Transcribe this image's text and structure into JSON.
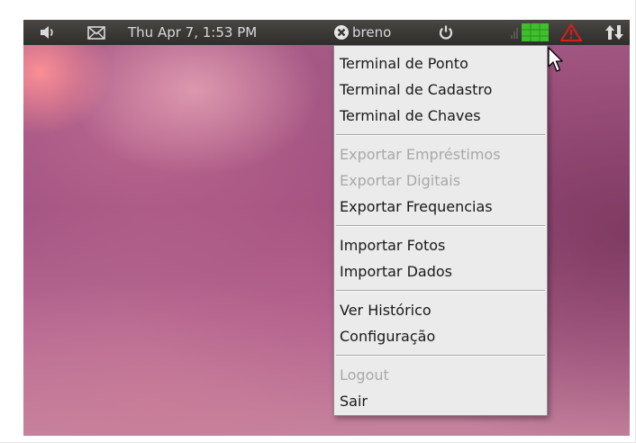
{
  "panel": {
    "datetime": "Thu Apr  7,  1:53 PM",
    "username": "breno",
    "icons": {
      "volume": "volume-icon",
      "mail": "mail-icon",
      "user": "user-x-icon",
      "power": "power-icon",
      "signal": "signal-bars-icon",
      "app_indicator": "green-grid-icon",
      "warning": "warning-triangle-icon",
      "network": "network-arrows-icon"
    }
  },
  "menu": {
    "groups": [
      [
        {
          "label": "Terminal de Ponto",
          "enabled": true
        },
        {
          "label": "Terminal de Cadastro",
          "enabled": true
        },
        {
          "label": "Terminal de Chaves",
          "enabled": true
        }
      ],
      [
        {
          "label": "Exportar Empréstimos",
          "enabled": false
        },
        {
          "label": "Exportar Digitais",
          "enabled": false
        },
        {
          "label": "Exportar Frequencias",
          "enabled": true
        }
      ],
      [
        {
          "label": "Importar Fotos",
          "enabled": true
        },
        {
          "label": "Importar Dados",
          "enabled": true
        }
      ],
      [
        {
          "label": "Ver Histórico",
          "enabled": true
        },
        {
          "label": "Configuração",
          "enabled": true
        }
      ],
      [
        {
          "label": "Logout",
          "enabled": false
        },
        {
          "label": "Sair",
          "enabled": true
        }
      ]
    ]
  },
  "colors": {
    "panel": "#3a3835",
    "menu_background": "#ebebeb",
    "menu_text": "#1a1a1a",
    "menu_text_disabled": "#a8a8a8",
    "indicator_green": "#3fbf2c",
    "warning_red": "#d61f1f"
  }
}
